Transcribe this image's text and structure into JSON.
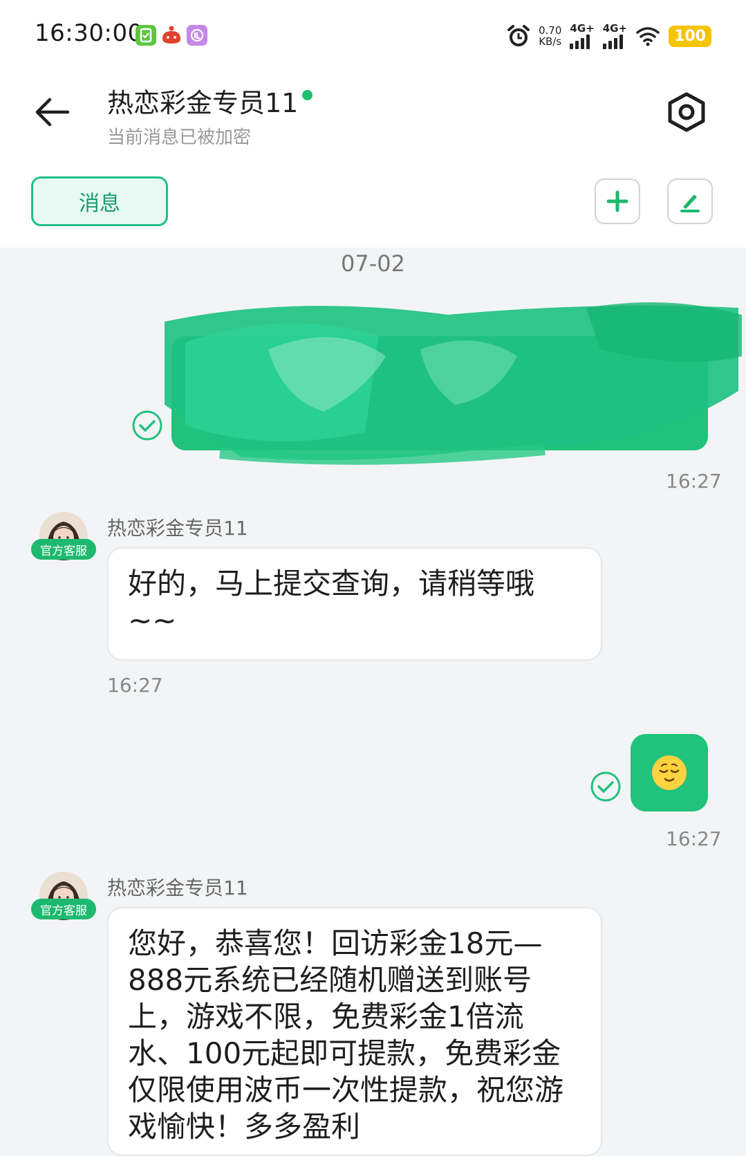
{
  "status_bar": {
    "time": "16:30:00",
    "net_speed_value": "0.70",
    "net_speed_unit": "KB/s",
    "signal_1_label": "4G+",
    "signal_2_label": "4G+",
    "battery": "100",
    "icons": [
      "app-green-icon",
      "app-red-icon",
      "app-purple-icon",
      "alarm-icon",
      "signal-icon",
      "wifi-icon",
      "battery-icon"
    ]
  },
  "header": {
    "title": "热恋彩金专员11",
    "subtitle": "当前消息已被加密",
    "online_color": "#1ec16c"
  },
  "toolbar": {
    "tab_label": "消息",
    "add_icon": "plus-icon",
    "edit_icon": "pen-icon"
  },
  "chat": {
    "date_divider": "07-02",
    "messages": [
      {
        "direction": "out",
        "type": "redacted",
        "time": "16:27"
      },
      {
        "direction": "in",
        "sender": "热恋彩金专员11",
        "badge": "官方客服",
        "text": "好的，马上提交查询，请稍等哦~~",
        "time": "16:27"
      },
      {
        "direction": "out",
        "type": "emoji",
        "emoji": "😌",
        "time": "16:27"
      },
      {
        "direction": "in",
        "sender": "热恋彩金专员11",
        "badge": "官方客服",
        "text": "您好，恭喜您！回访彩金18元—888元系统已经随机赠送到账号上，游戏不限，免费彩金1倍流水、100元起即可提款，免费彩金仅限使用波币一次性提款，祝您游戏愉快！多多盈利"
      }
    ]
  },
  "colors": {
    "accent_green": "#20c27c",
    "tab_border": "#1fbf8d",
    "badge_green": "#1db96f",
    "chat_bg": "#f3f4f6",
    "battery_yellow": "#f5c400"
  }
}
